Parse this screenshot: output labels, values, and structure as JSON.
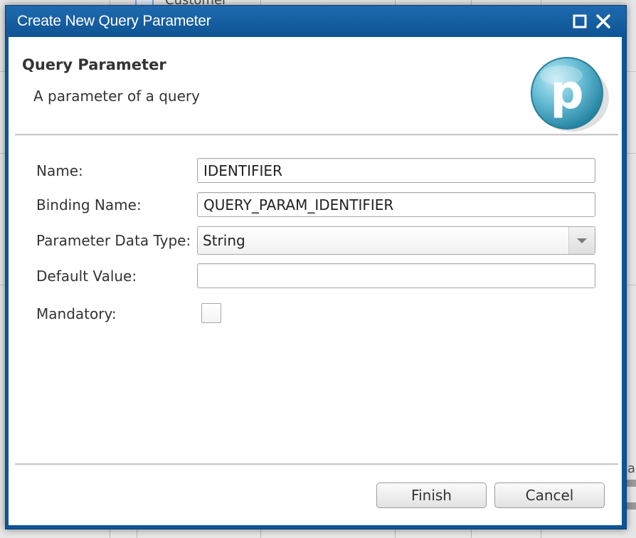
{
  "background": {
    "partial_text": "Customer",
    "edge_char": "a"
  },
  "dialog": {
    "title": "Create New Query Parameter",
    "accent_color": "#0f5494",
    "maximize_icon": "maximize-icon",
    "close_icon": "close-icon"
  },
  "header": {
    "title": "Query Parameter",
    "description": "A parameter of a query",
    "logo_letter": "p",
    "logo_icon": "parameter-logo-icon"
  },
  "form": {
    "name": {
      "label": "Name:",
      "value": "IDENTIFIER"
    },
    "binding_name": {
      "label": "Binding Name:",
      "value": "QUERY_PARAM_IDENTIFIER"
    },
    "data_type": {
      "label": "Parameter Data Type:",
      "value": "String"
    },
    "default_value": {
      "label": "Default Value:",
      "value": ""
    },
    "mandatory": {
      "label": "Mandatory:",
      "checked": false
    }
  },
  "buttons": {
    "finish": "Finish",
    "cancel": "Cancel"
  }
}
